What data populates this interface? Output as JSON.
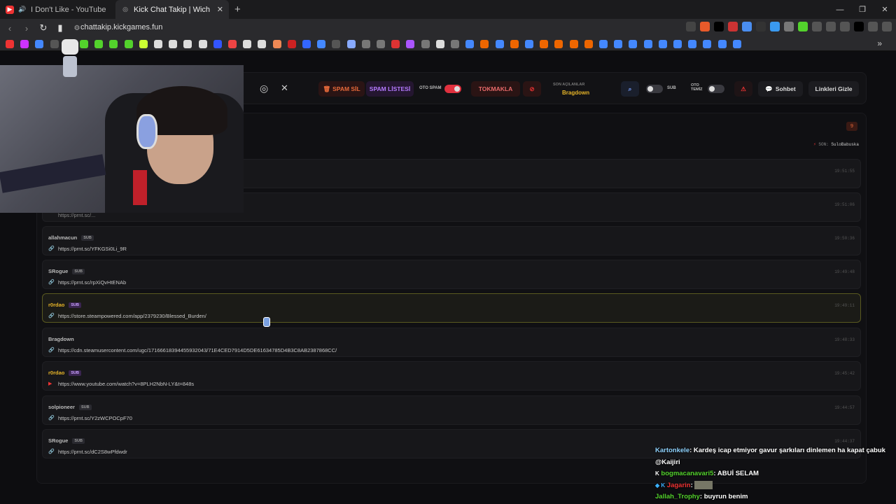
{
  "tabs": [
    {
      "label": "I Don't Like - YouTube"
    },
    {
      "label": "Kick Chat Takip | Wich"
    }
  ],
  "address": {
    "url": "chattakip.kickgames.fun"
  },
  "toolbar": {
    "spam_sil": "SPAM SİL",
    "spam_listesi": "SPAM LİSTESİ",
    "oto_spam": "OTO SPAM",
    "tokmakla": "TOKMAKLA",
    "son_acilanlar": "SON AÇILANLAR",
    "son_user": "Bragdown",
    "sub": "SUB",
    "oto_temiz_1": "OTO",
    "oto_temiz_2": "TEMİZ",
    "sohbet": "Sohbet",
    "linkleri_gizle": "Linkleri Gizle"
  },
  "header": {
    "count": "9",
    "son_label": "SON:",
    "son_user": "SuloBabuska"
  },
  "messages": [
    {
      "user": "allahmacun",
      "sub": "SUB",
      "link": "https://prnt.sc/YFKGSi0Li_9R",
      "time": "19:50:36",
      "gold": false,
      "hl": false,
      "yt": false
    },
    {
      "user": "SRogue",
      "sub": "SUB",
      "link": "https://prnt.sc/rpXiQvHtENAb",
      "time": "19:49:48",
      "gold": false,
      "hl": false,
      "yt": false
    },
    {
      "user": "r0rdao",
      "sub": "SUB",
      "link": "https://store.steampowered.com/app/2379230/Blessed_Burden/",
      "time": "19:49:11",
      "gold": true,
      "hl": true,
      "yt": false
    },
    {
      "user": "Bragdown",
      "sub": "",
      "link": "https://cdn.steamusercontent.com/ugc/17166618394455932043/71E4CED7914D5DE61634785D4B3C8AB2387868CC/",
      "time": "19:48:33",
      "gold": false,
      "hl": false,
      "yt": false
    },
    {
      "user": "r0rdao",
      "sub": "SUB",
      "link": "https://www.youtube.com/watch?v=8PLH2NbN-LY&t=848s",
      "time": "19:45:42",
      "gold": true,
      "hl": false,
      "yt": true
    },
    {
      "user": "solpioneer",
      "sub": "SUB",
      "link": "https://prnt.sc/Y2zWCPOCpF70",
      "time": "19:44:57",
      "gold": false,
      "hl": false,
      "yt": false
    },
    {
      "user": "SRogue",
      "sub": "SUB",
      "link": "https://prnt.sc/dC2S8wPfdwdr",
      "time": "19:44:37",
      "gold": false,
      "hl": false,
      "yt": false
    }
  ],
  "partial_times": [
    "19:51:55",
    "19:51:06"
  ],
  "partial_link": "https://prnt.sc/...",
  "chat_overlay": [
    {
      "user": "Kartonkele",
      "text": ": Kardeş icap etmiyor gavur şarkıları dinlemen ha kapat çabuk"
    },
    {
      "user": "",
      "text": "@Kaijiri"
    },
    {
      "user": "bogmacanavari5",
      "text": ": ABUİ SELAM"
    },
    {
      "user": "Jagarin",
      "text": ":"
    },
    {
      "user": "Jallah_Trophy",
      "text": ": buyrun benim"
    }
  ],
  "colors": {
    "accent": "#e0313f",
    "gold": "#e6b428",
    "purple": "#b57aff"
  }
}
